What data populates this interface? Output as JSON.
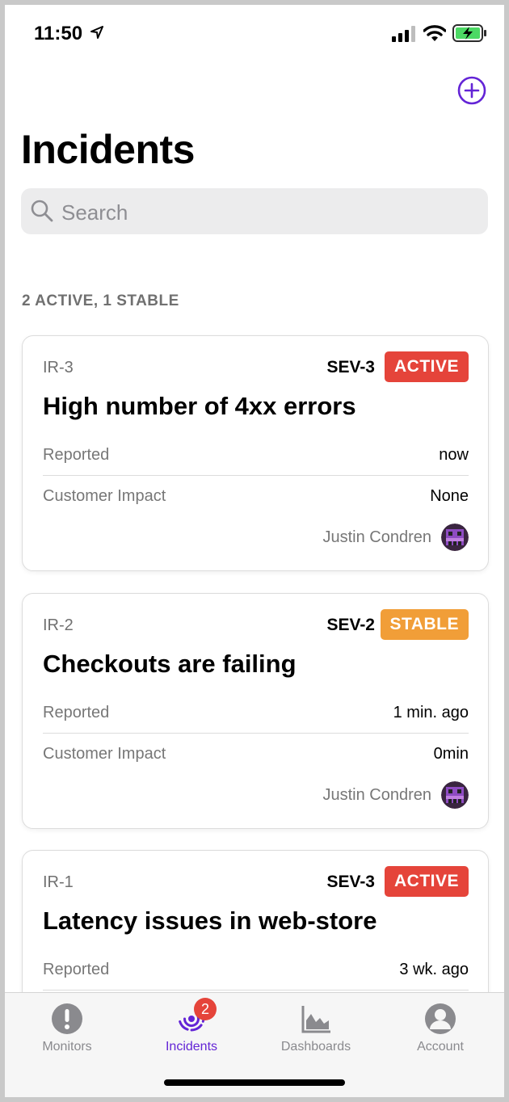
{
  "status_bar": {
    "time": "11:50"
  },
  "header": {
    "title": "Incidents",
    "add_icon": "plus-circle-icon",
    "accent": "#6324d6"
  },
  "search": {
    "placeholder": "Search",
    "value": ""
  },
  "section": {
    "summary": "2 ACTIVE, 1 STABLE"
  },
  "incidents": [
    {
      "id": "IR-3",
      "severity": "SEV-3",
      "status": "ACTIVE",
      "status_color": "#e5443a",
      "title": "High number of 4xx errors",
      "reported_label": "Reported",
      "reported_value": "now",
      "impact_label": "Customer Impact",
      "impact_value": "None",
      "user": "Justin Condren"
    },
    {
      "id": "IR-2",
      "severity": "SEV-2",
      "status": "STABLE",
      "status_color": "#f19e38",
      "title": "Checkouts are failing",
      "reported_label": "Reported",
      "reported_value": "1 min. ago",
      "impact_label": "Customer Impact",
      "impact_value": "0min",
      "user": "Justin Condren"
    },
    {
      "id": "IR-1",
      "severity": "SEV-3",
      "status": "ACTIVE",
      "status_color": "#e5443a",
      "title": "Latency issues in web-store",
      "reported_label": "Reported",
      "reported_value": "3 wk. ago",
      "impact_label": "",
      "impact_value": "",
      "user": ""
    }
  ],
  "tab_bar": {
    "tabs": [
      {
        "label": "Monitors",
        "icon": "exclamation-circle-icon"
      },
      {
        "label": "Incidents",
        "icon": "incidents-radar-icon",
        "badge": "2",
        "active": true
      },
      {
        "label": "Dashboards",
        "icon": "area-chart-icon"
      },
      {
        "label": "Account",
        "icon": "person-circle-icon"
      }
    ]
  }
}
